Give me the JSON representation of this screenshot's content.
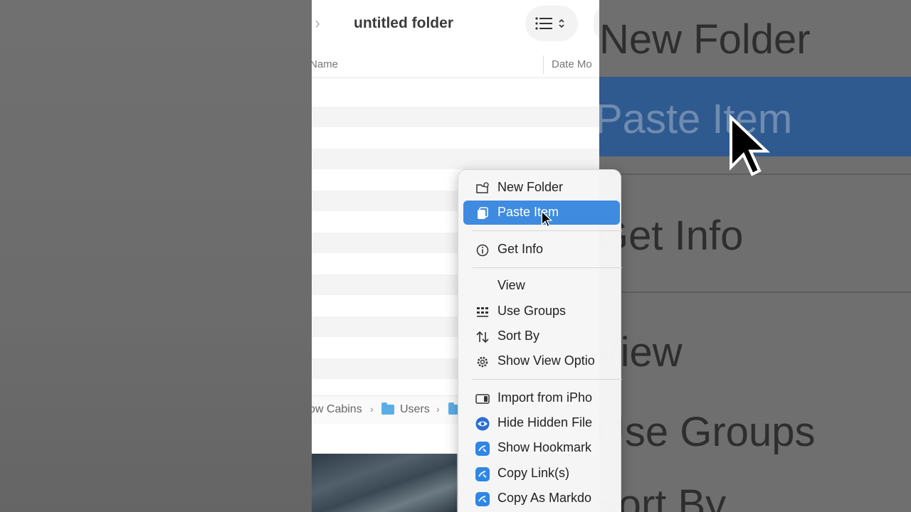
{
  "window": {
    "title": "untitled folder",
    "forward_glyph": "›"
  },
  "columns": {
    "name": "Name",
    "date": "Date Mo"
  },
  "pathbar": {
    "items": [
      "ow Cabins",
      "Users"
    ],
    "separator": "›"
  },
  "menu": {
    "items": [
      {
        "label": "New Folder",
        "icon": "new-folder-icon"
      },
      {
        "label": "Paste Item",
        "icon": "paste-icon",
        "highlighted": true
      },
      {
        "label": "Get Info",
        "icon": "info-icon"
      },
      {
        "label": "View",
        "icon": ""
      },
      {
        "label": "Use Groups",
        "icon": "groups-icon"
      },
      {
        "label": "Sort By",
        "icon": "sort-icon"
      },
      {
        "label": "Show View Optio",
        "icon": "gear-icon"
      },
      {
        "label": "Import from iPho",
        "icon": "device-icon"
      },
      {
        "label": "Hide Hidden File",
        "icon": "eye-icon"
      },
      {
        "label": "Show Hookmark",
        "icon": "hookmark-icon"
      },
      {
        "label": "Copy Link(s)",
        "icon": "hookmark-icon"
      },
      {
        "label": "Copy As Markdo",
        "icon": "hookmark-icon"
      }
    ]
  },
  "zoom": {
    "items": [
      "New Folder",
      "Paste Item",
      "Get Info",
      "View",
      "Use Groups",
      "Sort By"
    ]
  },
  "colors": {
    "highlight": "#3f8be0",
    "folder": "#5aaee8"
  }
}
